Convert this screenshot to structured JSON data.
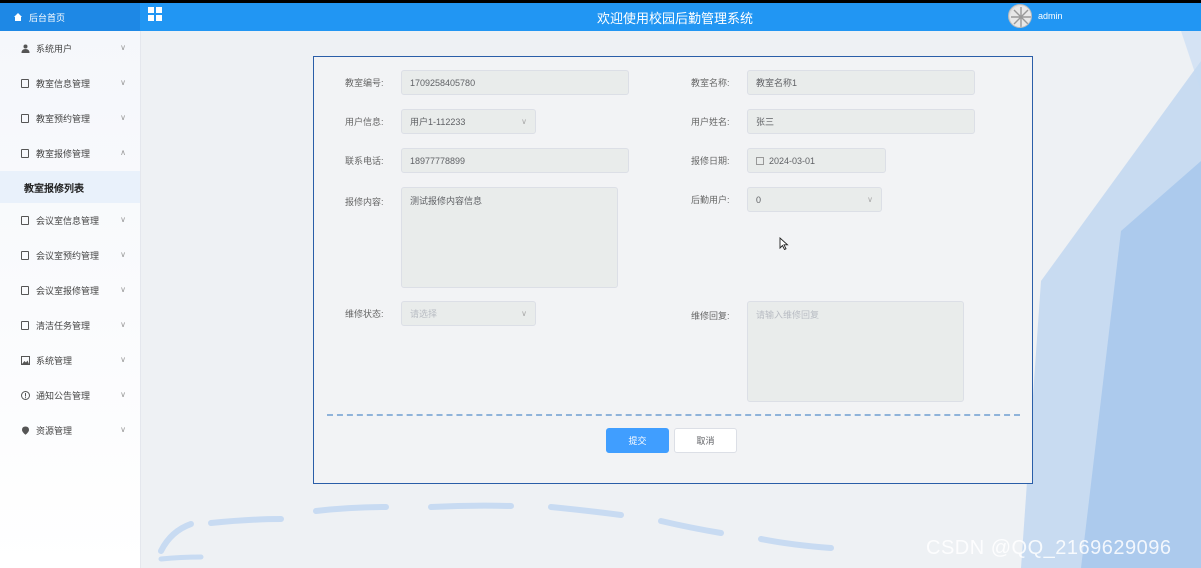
{
  "header": {
    "home_label": "后台首页",
    "title": "欢迎使用校园后勤管理系统",
    "username": "admin"
  },
  "sidebar": {
    "items": [
      {
        "label": "系统用户",
        "icon": "user-icon"
      },
      {
        "label": "教室信息管理",
        "icon": "document-icon"
      },
      {
        "label": "教室预约管理",
        "icon": "document-icon"
      },
      {
        "label": "教室报修管理",
        "icon": "document-icon",
        "expanded": true
      },
      {
        "label": "会议室信息管理",
        "icon": "document-icon"
      },
      {
        "label": "会议室预约管理",
        "icon": "document-icon"
      },
      {
        "label": "会议室报修管理",
        "icon": "document-icon"
      },
      {
        "label": "清洁任务管理",
        "icon": "document-icon"
      },
      {
        "label": "系统管理",
        "icon": "image-icon"
      },
      {
        "label": "通知公告管理",
        "icon": "info-icon"
      },
      {
        "label": "资源管理",
        "icon": "location-icon"
      }
    ],
    "active_sub": "教室报修列表"
  },
  "form": {
    "room_no": {
      "label": "教室编号:",
      "value": "1709258405780"
    },
    "room_name": {
      "label": "教室名称:",
      "value": "教室名称1"
    },
    "user_info": {
      "label": "用户信息:",
      "value": "用户1-112233"
    },
    "user_name": {
      "label": "用户姓名:",
      "value": "张三"
    },
    "phone": {
      "label": "联系电话:",
      "value": "18977778899"
    },
    "repair_date": {
      "label": "报修日期:",
      "value": "2024-03-01"
    },
    "repair_content": {
      "label": "报修内容:",
      "value": "测试报修内容信息"
    },
    "logistics_user": {
      "label": "后勤用户:",
      "value": "0"
    },
    "repair_status": {
      "label": "维修状态:",
      "placeholder": "请选择"
    },
    "repair_reply": {
      "label": "维修回复:",
      "placeholder": "请输入维修回复"
    },
    "submit_label": "提交",
    "cancel_label": "取消"
  },
  "watermark": "CSDN @QQ_2169629096",
  "colors": {
    "topbar": "#2196f3",
    "primary": "#409eff",
    "panel_border": "#2a5ea8"
  }
}
